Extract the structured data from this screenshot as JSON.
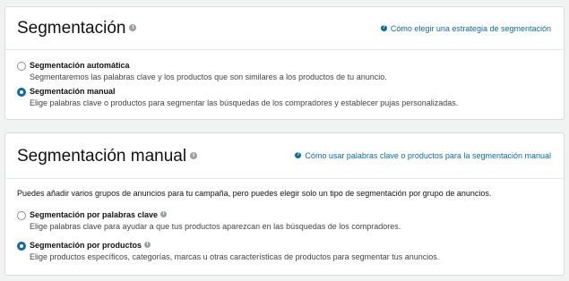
{
  "targeting": {
    "title": "Segmentación",
    "help_link": "Cómo elegir una estrategia de segmentación",
    "options": [
      {
        "label": "Segmentación automática",
        "description": "Segmentaremos las palabras clave y los productos que son similares a los productos de tu anuncio.",
        "selected": false
      },
      {
        "label": "Segmentación manual",
        "description": "Elige palabras clave o productos para segmentar las búsquedas de los compradores y establecer pujas personalizadas.",
        "selected": true
      }
    ]
  },
  "manual_targeting": {
    "title": "Segmentación manual",
    "help_link": "Cómo usar palabras clave o productos para la segmentación manual",
    "intro": "Puedes añadir varios grupos de anuncios para tu campaña, pero puedes elegir solo un tipo de segmentación por grupo de anuncios.",
    "options": [
      {
        "label": "Segmentación por palabras clave",
        "description": "Elige palabras clave para ayudar a que tus productos aparezcan en las búsquedas de los compradores.",
        "selected": false
      },
      {
        "label": "Segmentación por productos",
        "description": "Elige productos específicos, categorías, marcas u otras características de productos para segmentar tus anuncios.",
        "selected": true
      }
    ]
  },
  "icons": {
    "info": "info-icon",
    "help": "help-circle-icon"
  },
  "colors": {
    "accent": "#0b6ba6",
    "page_bg": "#f1f2f2"
  }
}
